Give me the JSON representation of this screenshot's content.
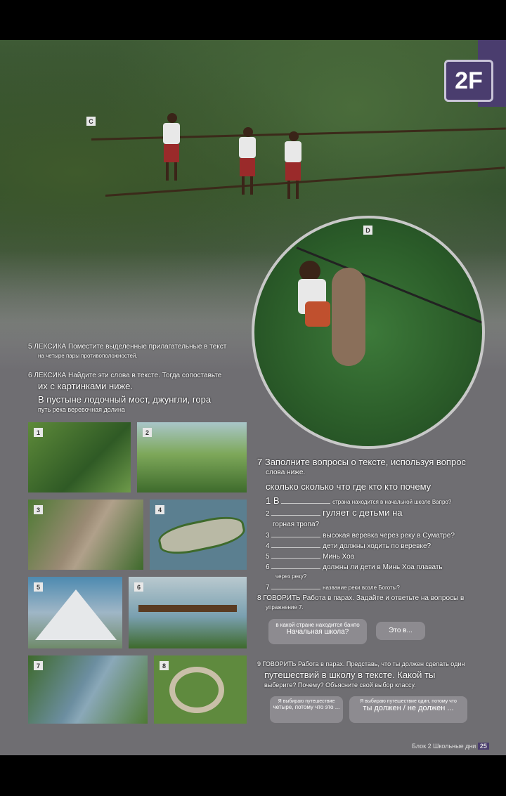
{
  "unit_badge": "2F",
  "photo_labels": {
    "c": "C",
    "d": "D"
  },
  "ex5": {
    "line1": "5 ЛЕКСИКА Поместите выделенные прилагательные в текст",
    "line2": "на четыре пары противоположностей."
  },
  "ex6": {
    "line1": "6 ЛЕКСИКА Найдите эти слова в тексте. Тогда сопоставьте",
    "line2": "их с картинками ниже.",
    "line3": "В пустыне лодочный мост, джунгли, гора",
    "line4": "путь река веревочная долина"
  },
  "pictures": [
    {
      "num": "1",
      "desc": "jungle"
    },
    {
      "num": "2",
      "desc": "valley"
    },
    {
      "num": "3",
      "desc": "path"
    },
    {
      "num": "4",
      "desc": "boat"
    },
    {
      "num": "5",
      "desc": "mountain"
    },
    {
      "num": "6",
      "desc": "bridge"
    },
    {
      "num": "7",
      "desc": "river"
    },
    {
      "num": "8",
      "desc": "rope"
    }
  ],
  "ex7": {
    "line1": "7 Заполните вопросы о тексте, используя вопрос",
    "line2": "слова ниже.",
    "words": "сколько сколько что где кто кто почему",
    "q1": "1 В",
    "q1_text": "страна находится в начальной школе Вапро?",
    "q2_num": "2",
    "q2_text": "гуляет с детьми на",
    "q2_text2": "горная тропа?",
    "q3_num": "3",
    "q3_text": "высокая веревка через реку в Суматре?",
    "q4_num": "4",
    "q4_text": "дети должны ходить по веревке?",
    "q5_num": "5",
    "q5_text": "Минь Хоа",
    "q6_num": "6",
    "q6_text": "должны ли дети в Минь Хоа плавать",
    "q6_text2": "через реку?",
    "q7_num": "7",
    "q7_text": "название реки возле Боготы?"
  },
  "ex8": {
    "line1": "8 ГОВОРИТЬ Работа в парах. Задайте и ответьте на вопросы в",
    "line2": "упражнение 7.",
    "bubble1_a": "в какой стране находится банпо",
    "bubble1_b": "Начальная школа?",
    "bubble2": "Это в..."
  },
  "ex9": {
    "line1": "9 ГОВОРИТЬ Работа в парах. Представь, что ты должен сделать один",
    "line2": "путешествий в школу в тексте. Какой ты",
    "line3": "выберите? Почему? Объясните свой выбор классу.",
    "bubble1_a": "Я выбираю путешествие",
    "bubble1_b": "четыре, потому что это ...",
    "bubble2_a": "Я выбираю путешествие один, потому что",
    "bubble2_b": "ты должен / не должен ..."
  },
  "footer": {
    "text": "Блок 2 Школьные дни",
    "page": "25"
  }
}
